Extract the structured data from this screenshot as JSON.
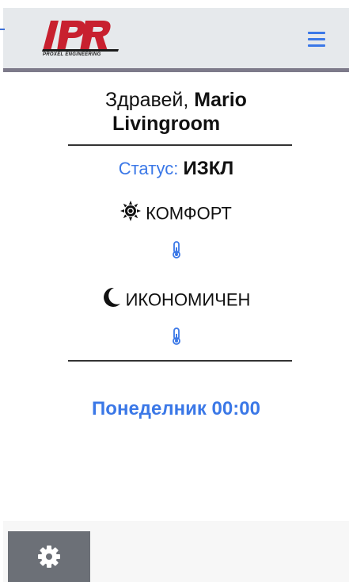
{
  "header": {
    "logo_text": "PR",
    "logo_tagline": "PROXEL ENGINEERING",
    "menu_icon": "hamburger-menu-icon"
  },
  "greeting": {
    "prefix": "Здравей, ",
    "user_name": "Mario",
    "room": "Livingroom"
  },
  "status": {
    "label": "Статус: ",
    "value": "ИЗКЛ"
  },
  "modes": [
    {
      "icon": "sun-icon",
      "label": "КОМФОРТ"
    },
    {
      "icon": "moon-icon",
      "label": "ИКОНОМИЧЕН"
    }
  ],
  "schedule": {
    "day_time": "Понеделник 00:00"
  },
  "footer": {
    "settings_icon": "gear-icon"
  },
  "colors": {
    "accent": "#3b78e7",
    "header_bg": "#e6e9ec",
    "settings_bg": "#6c7077",
    "logo_red": "#c8202f"
  }
}
